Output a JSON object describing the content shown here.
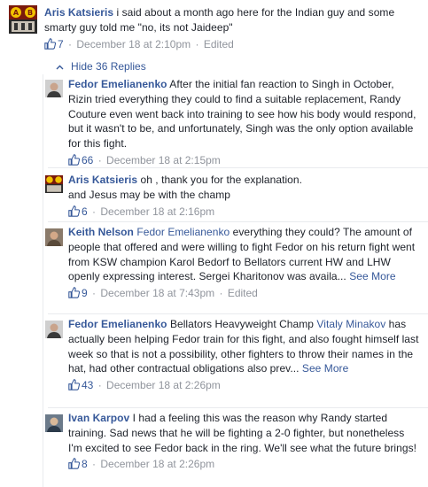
{
  "top_comment": {
    "author": "Aris Katsieris",
    "text": "i said about a month ago here for the Indian guy and some smarty guy told me \"no, its not Jaideep\"",
    "likes": "7",
    "date": "December 18 at 2:10pm",
    "edited": "Edited"
  },
  "hide_replies_label": "Hide 36 Replies",
  "replies": [
    {
      "author": "Fedor Emelianenko",
      "text": "After the initial fan reaction to Singh in October, Rizin tried everything they could to find a suitable replacement, Randy Couture even went back into training to see how his body would respond, but it wasn't to be, and unfortunately, Singh was the only option available for this fight.",
      "likes": "66",
      "date": "December 18 at 2:15pm"
    },
    {
      "author": "Aris Katsieris",
      "text_line1": "oh , thank you for the explanation.",
      "text_line2": "and Jesus may be with the champ",
      "likes": "6",
      "date": "December 18 at 2:16pm"
    },
    {
      "author": "Keith Nelson",
      "mention": "Fedor Emelianenko",
      "text": "everything they could? The amount of people that offered and were willing to fight Fedor on his return fight went from KSW champion Karol Bedorf to Bellators current HW and LHW openly expressing interest. Sergei Kharitonov was availa...",
      "see_more": "See More",
      "likes": "9",
      "date": "December 18 at 7:43pm",
      "edited": "Edited"
    },
    {
      "author": "Fedor Emelianenko",
      "text_before": "Bellators Heavyweight Champ",
      "mention": "Vitaly Minakov",
      "text_after": "has actually been helping Fedor train for this fight, and also fought himself last week so that is not a possibility, other fighters to throw their names in the hat, had other contractual obligations also prev...",
      "see_more": "See More",
      "likes": "43",
      "date": "December 18 at 2:26pm"
    },
    {
      "author": "Ivan Karpov",
      "text": "I had a feeling this was the reason why Randy started training. Sad news that he will be fighting a 2-0 fighter, but nonetheless I'm excited to see Fedor back in the ring. We'll see what the future brings!",
      "likes": "8",
      "date": "December 18 at 2:26pm"
    }
  ],
  "colors": {
    "link": "#365899",
    "meta": "#90949c",
    "text": "#1d2129",
    "divider": "#e9ebee"
  },
  "icons": {
    "like": "thumbs-up-icon",
    "collapse": "chevron-up-icon"
  }
}
